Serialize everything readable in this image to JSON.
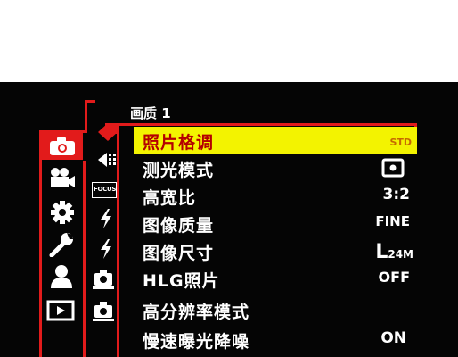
{
  "page_title": "画质 1",
  "menu_items": [
    {
      "label": "照片格调",
      "value": "STD",
      "selected": true
    },
    {
      "label": "测光模式",
      "value": "",
      "selected": false
    },
    {
      "label": "高宽比",
      "value": "3:2",
      "selected": false
    },
    {
      "label": "图像质量",
      "value": "FINE",
      "selected": false
    },
    {
      "label": "图像尺寸",
      "value_main": "L",
      "value_sub": "24M",
      "selected": false
    },
    {
      "label": "HLG照片",
      "value": "OFF",
      "selected": false
    },
    {
      "label": "高分辨率模式",
      "value": "",
      "selected": false
    },
    {
      "label": "慢速曝光降噪",
      "value": "ON",
      "selected": false
    }
  ],
  "sub_tab_labels": {
    "focus": "FOCUS"
  },
  "icons": {
    "main_tabs": [
      "camera-icon",
      "video-camera-icon",
      "gear-icon",
      "wrench-icon",
      "person-icon",
      "playback-icon"
    ],
    "sub_tabs": [
      "image-quality-diamond-icon",
      "dotted-arrow-icon",
      "focus-icon",
      "flash-icon",
      "flash-icon",
      "camera-settings-icon",
      "camera-settings-icon"
    ]
  },
  "colors": {
    "accent_red": "#e21b1b",
    "highlight_yellow": "#f3f300",
    "selected_text": "#b40000"
  }
}
